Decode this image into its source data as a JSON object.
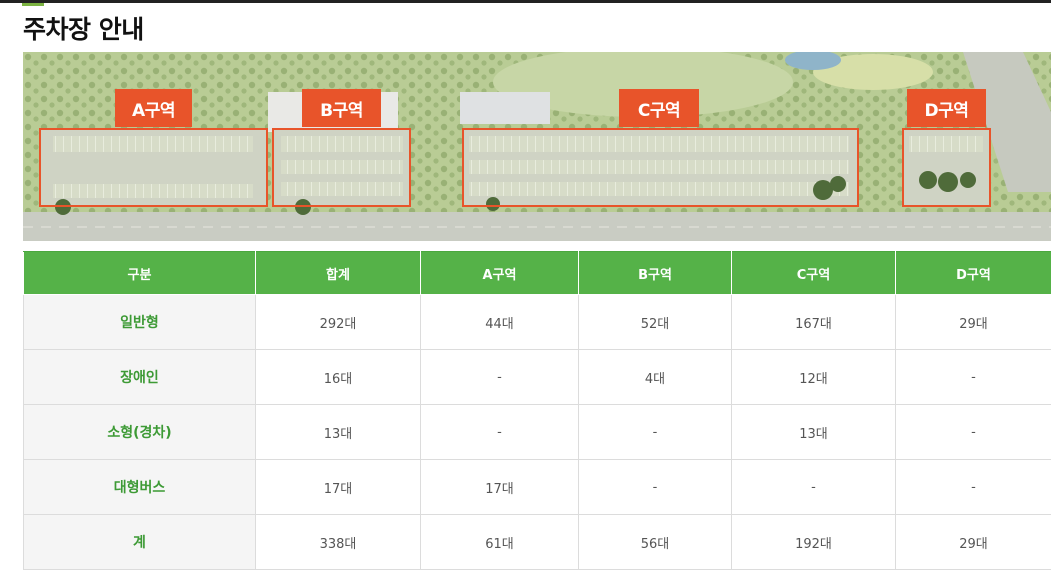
{
  "page": {
    "title": "주차장 안내"
  },
  "map": {
    "zones": [
      {
        "id": "A",
        "label": "A구역"
      },
      {
        "id": "B",
        "label": "B구역"
      },
      {
        "id": "C",
        "label": "C구역"
      },
      {
        "id": "D",
        "label": "D구역"
      }
    ],
    "colors": {
      "zone_label_bg": "#e8542a",
      "zone_outline": "#e8542a",
      "grass": "#b9cc95",
      "road": "#c9ccc3"
    }
  },
  "table": {
    "headers": [
      "구분",
      "합계",
      "A구역",
      "B구역",
      "C구역",
      "D구역"
    ],
    "rows": [
      {
        "category": "일반형",
        "cells": [
          "292대",
          "44대",
          "52대",
          "167대",
          "29대"
        ]
      },
      {
        "category": "장애인",
        "cells": [
          "16대",
          "-",
          "4대",
          "12대",
          "-"
        ]
      },
      {
        "category": "소형(경차)",
        "cells": [
          "13대",
          "-",
          "-",
          "13대",
          "-"
        ]
      },
      {
        "category": "대형버스",
        "cells": [
          "17대",
          "17대",
          "-",
          "-",
          "-"
        ]
      },
      {
        "category": "계",
        "cells": [
          "338대",
          "61대",
          "56대",
          "192대",
          "29대"
        ]
      }
    ],
    "colors": {
      "header_bg": "#55b248",
      "row_head_text": "#3d9a35"
    }
  }
}
